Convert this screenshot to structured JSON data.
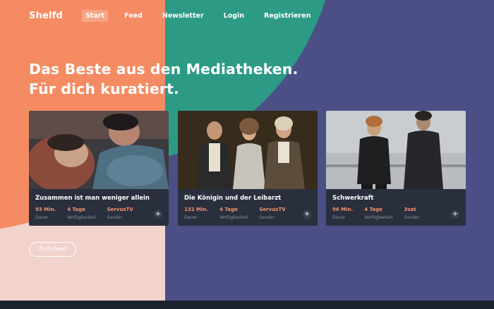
{
  "brand": {
    "logo": "Shelfd"
  },
  "nav": {
    "items": [
      {
        "label": "Start",
        "active": true
      },
      {
        "label": "Feed"
      },
      {
        "label": "Newsletter"
      },
      {
        "label": "Login"
      },
      {
        "label": "Registrieren"
      }
    ]
  },
  "hero": {
    "line1": "Das Beste aus den Mediatheken.",
    "line2": "Für dich kuratiert."
  },
  "cards": [
    {
      "title": "Zusammen ist man weniger allein",
      "duration": "93 Min.",
      "availability": "4 Tage",
      "channel": "ServusTV",
      "labels": {
        "duration": "Dauer",
        "availability": "Verfügbarkeit",
        "channel": "Sender"
      }
    },
    {
      "title": "Die Königin und der Leibarzt",
      "duration": "132 Min.",
      "availability": "4 Tage",
      "channel": "ServusTV",
      "labels": {
        "duration": "Dauer",
        "availability": "Verfügbarkeit",
        "channel": "Sender"
      }
    },
    {
      "title": "Schwerkraft",
      "duration": "96 Min.",
      "availability": "4 Tage",
      "channel": "3sat",
      "labels": {
        "duration": "Dauer",
        "availability": "Verfügbarkeit",
        "channel": "Sender"
      }
    }
  ],
  "cta": {
    "label": "Zum Feed"
  },
  "icons": {
    "add": "plus-icon"
  },
  "colors": {
    "accent": "#f58b63",
    "teal": "#2d9a86",
    "indigo": "#4b4f86",
    "card_bg": "#2a2f3e"
  }
}
